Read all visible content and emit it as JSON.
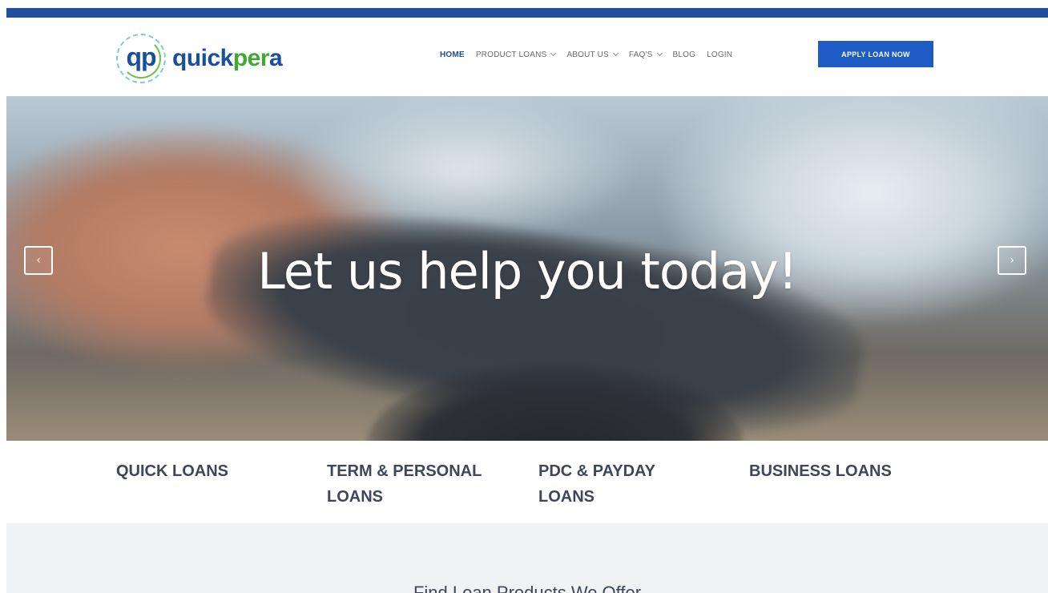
{
  "brand": {
    "logo_mark": "qp",
    "logo_word_part1": "quick",
    "logo_word_part2": "per",
    "logo_word_part3": "a",
    "primary_color": "#1a4f9c",
    "accent_color": "#3cab2e"
  },
  "nav": {
    "items": [
      {
        "label": "HOME",
        "active": true,
        "has_dropdown": false
      },
      {
        "label": "PRODUCT LOANS",
        "active": false,
        "has_dropdown": true
      },
      {
        "label": "ABOUT US",
        "active": false,
        "has_dropdown": true
      },
      {
        "label": "FAQ'S",
        "active": false,
        "has_dropdown": true
      },
      {
        "label": "BLOG",
        "active": false,
        "has_dropdown": false
      },
      {
        "label": "LOGIN",
        "active": false,
        "has_dropdown": false
      }
    ],
    "cta_label": "APPLY LOAN NOW",
    "cta_color": "#1e5bc4"
  },
  "hero": {
    "title": "Let us help you today!",
    "prev_icon": "chevron-left-icon",
    "next_icon": "chevron-right-icon",
    "prev_glyph": "‹",
    "next_glyph": "›"
  },
  "loan_categories": [
    {
      "label": "QUICK LOANS"
    },
    {
      "label": "TERM & PERSONAL LOANS"
    },
    {
      "label": "PDC & PAYDAY LOANS"
    },
    {
      "label": "BUSINESS LOANS"
    }
  ],
  "section": {
    "title": "Find Loan Products We Offer"
  }
}
